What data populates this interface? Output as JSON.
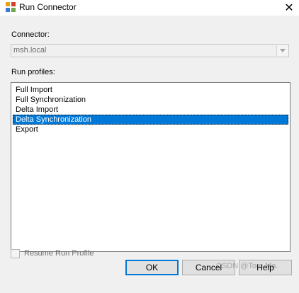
{
  "window": {
    "title": "Run Connector",
    "icon": "app-icon",
    "close_symbol": "✕"
  },
  "connector": {
    "label": "Connector:",
    "value": "msh.local",
    "disabled": true
  },
  "run_profiles": {
    "label": "Run profiles:",
    "items": [
      {
        "label": "Full Import",
        "selected": false
      },
      {
        "label": "Full Synchronization",
        "selected": false
      },
      {
        "label": "Delta Import",
        "selected": false
      },
      {
        "label": "Delta Synchronization",
        "selected": true
      },
      {
        "label": "Export",
        "selected": false
      }
    ]
  },
  "resume": {
    "label": "Resume Run Profile",
    "checked": false,
    "disabled": true
  },
  "buttons": {
    "ok": "OK",
    "cancel": "Cancel",
    "help": "Help"
  },
  "watermark": "CSDN @Tom Ma.",
  "colors": {
    "selection": "#0078d7",
    "client_bg": "#f0f0f0",
    "disabled_text": "#6d6d6d"
  }
}
